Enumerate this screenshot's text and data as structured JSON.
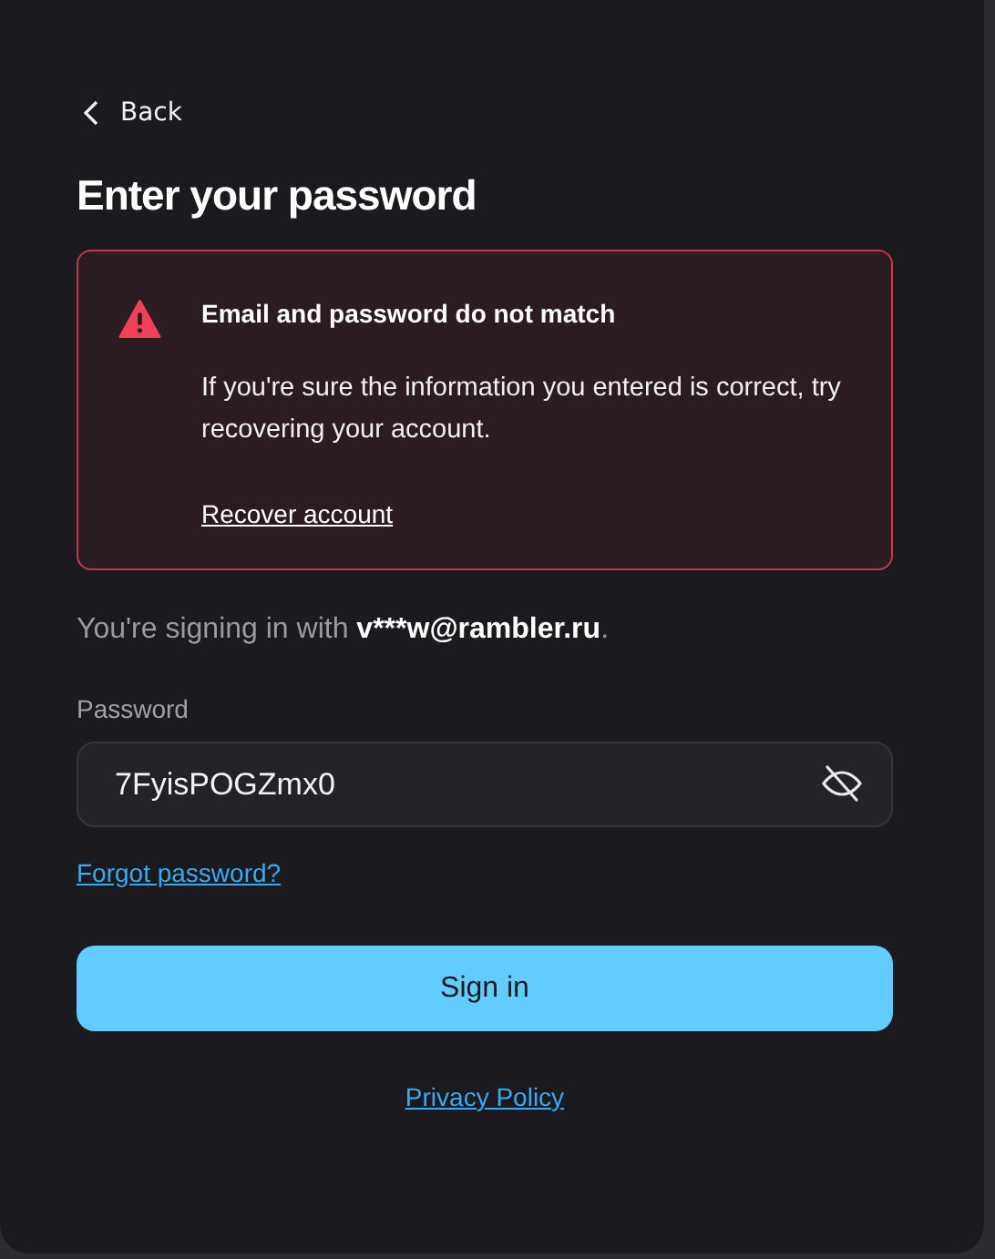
{
  "back": {
    "label": "Back"
  },
  "title": "Enter your password",
  "alert": {
    "title": "Email and password do not match",
    "message": "If you're sure the information you entered is correct, try recovering your account.",
    "link": "Recover account"
  },
  "signing_in": {
    "before": "You're signing in with ",
    "email": "v***w@rambler.ru",
    "after": "."
  },
  "password": {
    "label": "Password",
    "value": "7FyisPOGZmx0",
    "revealed": true
  },
  "forgot_link": "Forgot password?",
  "submit": "Sign in",
  "privacy_link": "Privacy Policy"
}
